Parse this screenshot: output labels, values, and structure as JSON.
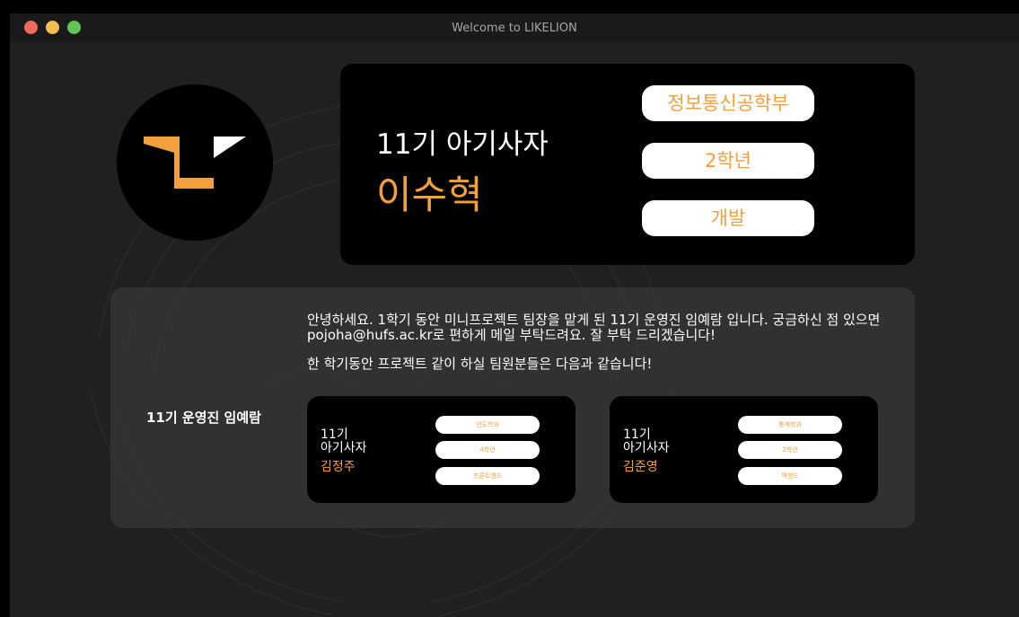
{
  "window": {
    "title": "Welcome to LIKELION"
  },
  "hero": {
    "generation": "11기 아기사자",
    "name": "이수혁",
    "tags": [
      "정보통신공학부",
      "2학년",
      "개발"
    ]
  },
  "intro": {
    "paragraph1": "안녕하세요. 1학기 동안 미니프로젝트 팀장을 맡게 된 11기 운영진 임예람 입니다. 궁금하신 점 있으면 pojoha@hufs.ac.kr로 편하게 메일 부탁드려요. 잘 부탁 드리겠습니다!",
    "paragraph2": "한 학기동안 프로젝트 같이 하실 팀원분들은 다음과 같습니다!"
  },
  "leader_label": "11기 운영진 임예람",
  "members": [
    {
      "gen_line1": "11기",
      "gen_line2": "아기사자",
      "name": "김정주",
      "tags": [
        "인도학과",
        "4학년",
        "프론트엔드"
      ]
    },
    {
      "gen_line1": "11기",
      "gen_line2": "아기사자",
      "name": "김준영",
      "tags": [
        "통계학과",
        "2학년",
        "백엔드"
      ]
    }
  ],
  "colors": {
    "accent": "#f2a03d",
    "card": "#000000",
    "panel": "#373737"
  }
}
